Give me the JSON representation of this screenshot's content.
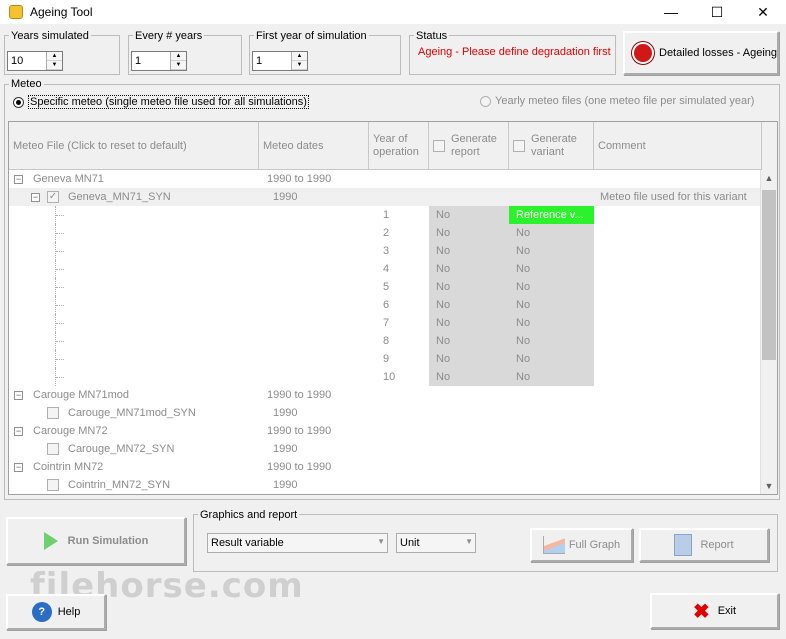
{
  "window": {
    "title": "Ageing Tool",
    "minimize": "—",
    "maximize": "☐",
    "close": "✕"
  },
  "years_simulated": {
    "label": "Years simulated",
    "value": "10"
  },
  "every_years": {
    "label": "Every # years",
    "value": "1"
  },
  "first_year": {
    "label": "First year of simulation",
    "value": "1"
  },
  "status": {
    "label": "Status",
    "text": "Ageing - Please define degradation first"
  },
  "detailed_button": {
    "label": "Detailed losses - Ageing"
  },
  "meteo": {
    "label": "Meteo",
    "option_specific": "Specific meteo (single meteo file used for all simulations)",
    "option_yearly": "Yearly meteo files (one meteo file per simulated year)"
  },
  "grid": {
    "columns": [
      "Meteo File (Click to reset to default)",
      "Meteo dates",
      "Year of operation",
      "Generate report",
      "Generate variant",
      "Comment"
    ],
    "groups": [
      {
        "name": "Geneva MN71",
        "dates": "1990 to 1990"
      },
      {
        "name": "Carouge MN71mod",
        "dates": "1990 to 1990"
      },
      {
        "name": "Carouge MN72",
        "dates": "1990 to 1990"
      },
      {
        "name": "Cointrin MN72",
        "dates": "1990 to 1990"
      }
    ],
    "files": [
      {
        "name": "Geneva_MN71_SYN",
        "year": "1990",
        "comment": "Meteo file used for this variant"
      },
      {
        "name": "Carouge_MN71mod_SYN",
        "year": "1990"
      },
      {
        "name": "Carouge_MN72_SYN",
        "year": "1990"
      },
      {
        "name": "Cointrin_MN72_SYN",
        "year": "1990"
      }
    ],
    "years": [
      {
        "year": "1",
        "report": "No",
        "variant": "Reference v..."
      },
      {
        "year": "2",
        "report": "No",
        "variant": "No"
      },
      {
        "year": "3",
        "report": "No",
        "variant": "No"
      },
      {
        "year": "4",
        "report": "No",
        "variant": "No"
      },
      {
        "year": "5",
        "report": "No",
        "variant": "No"
      },
      {
        "year": "6",
        "report": "No",
        "variant": "No"
      },
      {
        "year": "7",
        "report": "No",
        "variant": "No"
      },
      {
        "year": "8",
        "report": "No",
        "variant": "No"
      },
      {
        "year": "9",
        "report": "No",
        "variant": "No"
      },
      {
        "year": "10",
        "report": "No",
        "variant": "No"
      }
    ]
  },
  "run_button": {
    "label": "Run Simulation"
  },
  "graphics": {
    "label": "Graphics and report",
    "result_variable": "Result variable",
    "unit": "Unit",
    "full_graph": "Full Graph",
    "report": "Report"
  },
  "watermark": {
    "text": "filehorse.com"
  },
  "help_button": {
    "label": "Help"
  },
  "exit_button": {
    "label": "Exit"
  }
}
